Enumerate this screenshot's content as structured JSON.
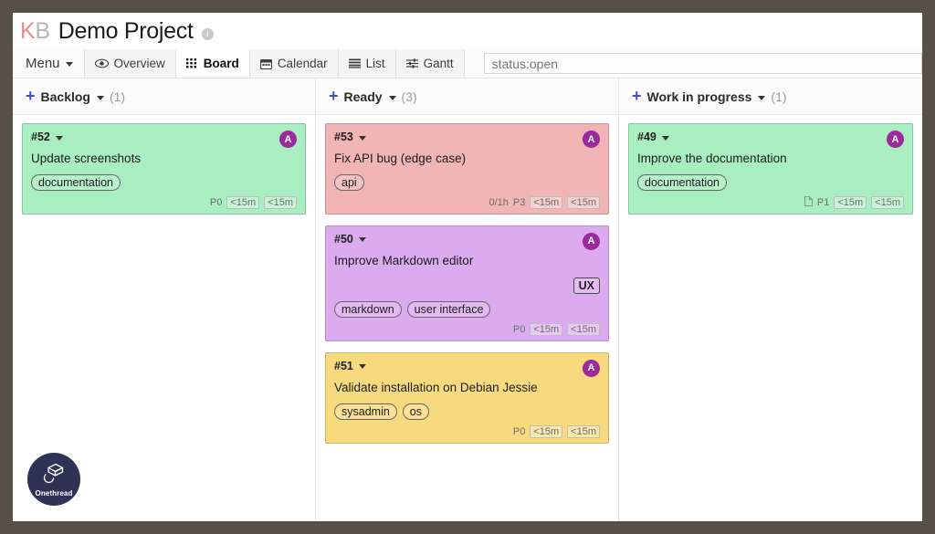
{
  "header": {
    "brand_k": "K",
    "brand_b": "B",
    "project_title": "Demo Project",
    "info_icon": "info-icon"
  },
  "nav": {
    "menu_label": "Menu",
    "tabs": [
      {
        "label": "Overview",
        "icon": "eye-icon",
        "active": false
      },
      {
        "label": "Board",
        "icon": "grid-icon",
        "active": true
      },
      {
        "label": "Calendar",
        "icon": "calendar-icon",
        "active": false
      },
      {
        "label": "List",
        "icon": "list-icon",
        "active": false
      },
      {
        "label": "Gantt",
        "icon": "sliders-icon",
        "active": false
      }
    ],
    "search": {
      "value": "status:open",
      "placeholder": "status:open"
    }
  },
  "colors": {
    "accent_blue": "#3f51b5",
    "avatar_purple": "#9c2a9c",
    "card_green": "#a8eec0",
    "card_pink": "#f2b5b5",
    "card_purple": "#dcaaee",
    "card_yellow": "#f7da7e",
    "frame_border": "#575049",
    "logo_navy": "#2e3356"
  },
  "board": {
    "columns": [
      {
        "title": "Backlog",
        "count": "(1)",
        "add_icon": "plus-icon",
        "cards": [
          {
            "id": "#52",
            "title": "Update screenshots",
            "color": "#a8eec0",
            "avatar": "A",
            "square_badge": "",
            "tags": [
              "documentation"
            ],
            "footer": {
              "doc_icon": false,
              "time_spent": "",
              "priority": "P0",
              "time_boxes": [
                "<15m",
                "<15m"
              ]
            }
          }
        ]
      },
      {
        "title": "Ready",
        "count": "(3)",
        "add_icon": "plus-icon",
        "cards": [
          {
            "id": "#53",
            "title": "Fix API bug (edge case)",
            "color": "#f2b5b5",
            "avatar": "A",
            "square_badge": "",
            "tags": [
              "api"
            ],
            "footer": {
              "doc_icon": false,
              "time_spent": "0/1h",
              "priority": "P3",
              "time_boxes": [
                "<15m",
                "<15m"
              ]
            }
          },
          {
            "id": "#50",
            "title": "Improve Markdown editor",
            "color": "#dcaaee",
            "avatar": "A",
            "square_badge": "UX",
            "tags": [
              "markdown",
              "user interface"
            ],
            "footer": {
              "doc_icon": false,
              "time_spent": "",
              "priority": "P0",
              "time_boxes": [
                "<15m",
                "<15m"
              ]
            }
          },
          {
            "id": "#51",
            "title": "Validate installation on Debian Jessie",
            "color": "#f7da7e",
            "avatar": "A",
            "square_badge": "",
            "tags": [
              "sysadmin",
              "os"
            ],
            "footer": {
              "doc_icon": false,
              "time_spent": "",
              "priority": "P0",
              "time_boxes": [
                "<15m",
                "<15m"
              ]
            }
          }
        ]
      },
      {
        "title": "Work in progress",
        "count": "(1)",
        "add_icon": "plus-icon",
        "cards": [
          {
            "id": "#49",
            "title": "Improve the documentation",
            "color": "#a8eec0",
            "avatar": "A",
            "square_badge": "",
            "tags": [
              "documentation"
            ],
            "footer": {
              "doc_icon": true,
              "time_spent": "",
              "priority": "P1",
              "time_boxes": [
                "<15m",
                "<15m"
              ]
            }
          }
        ]
      }
    ]
  },
  "logo": {
    "text": "Onethread",
    "icon": "onethread-logo-icon"
  }
}
